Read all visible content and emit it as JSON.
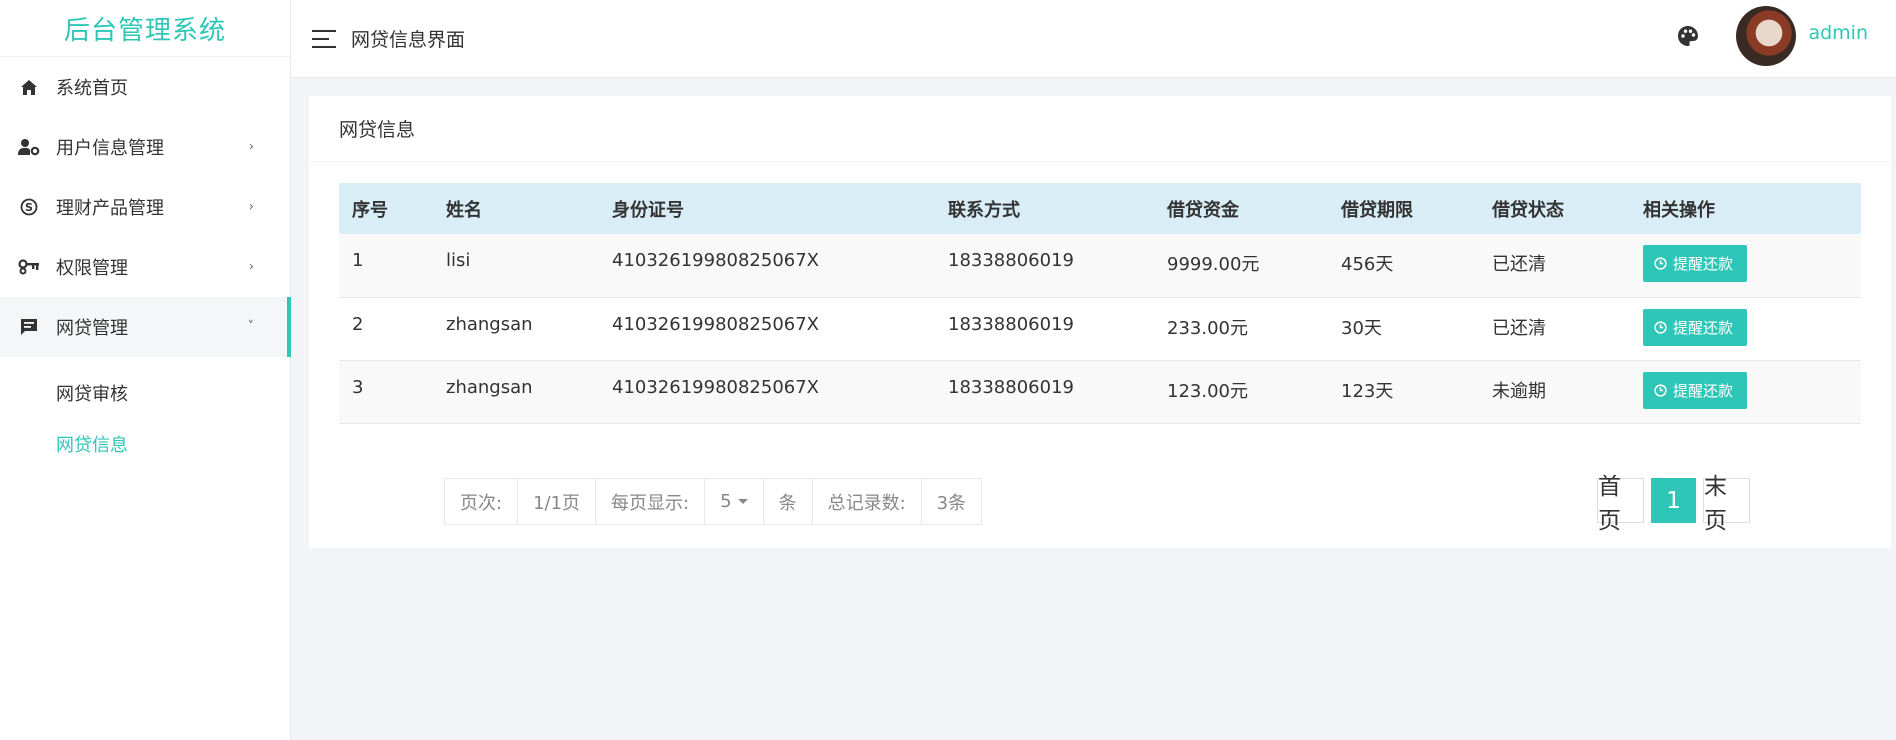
{
  "app": {
    "title": "后台管理系统"
  },
  "sidebar": {
    "items": [
      {
        "label": "系统首页",
        "icon": "home-icon",
        "has_arrow": false
      },
      {
        "label": "用户信息管理",
        "icon": "user-gear-icon",
        "arrow": "›"
      },
      {
        "label": "理财产品管理",
        "icon": "skype-icon",
        "arrow": "›"
      },
      {
        "label": "权限管理",
        "icon": "key-icon",
        "arrow": "›"
      },
      {
        "label": "网贷管理",
        "icon": "message-icon",
        "arrow": "˅",
        "open": true
      }
    ],
    "sub_items": [
      {
        "label": "网贷审核",
        "active": false
      },
      {
        "label": "网贷信息",
        "active": true
      }
    ]
  },
  "header": {
    "title": "网贷信息界面",
    "username": "admin"
  },
  "card": {
    "title": "网贷信息"
  },
  "table": {
    "columns": [
      "序号",
      "姓名",
      "身份证号",
      "联系方式",
      "借贷资金",
      "借贷期限",
      "借贷状态",
      "相关操作"
    ],
    "rows": [
      {
        "no": "1",
        "name": "lisi",
        "id_card": "41032619980825067X",
        "phone": "18338806019",
        "amount": "9999.00元",
        "term": "456天",
        "status": "已还清",
        "action": "提醒还款"
      },
      {
        "no": "2",
        "name": "zhangsan",
        "id_card": "41032619980825067X",
        "phone": "18338806019",
        "amount": "233.00元",
        "term": "30天",
        "status": "已还清",
        "action": "提醒还款"
      },
      {
        "no": "3",
        "name": "zhangsan",
        "id_card": "41032619980825067X",
        "phone": "18338806019",
        "amount": "123.00元",
        "term": "123天",
        "status": "未逾期",
        "action": "提醒还款"
      }
    ]
  },
  "pager": {
    "page_label": "页次:",
    "page_value": "1/1页",
    "per_page_label": "每页显示:",
    "per_page_value": "5",
    "unit": "条",
    "total_label": "总记录数:",
    "total_value": "3条",
    "first": "首页",
    "current": "1",
    "last": "末页"
  },
  "colors": {
    "accent": "#2ec7b7",
    "table_header": "#d9edf6"
  }
}
